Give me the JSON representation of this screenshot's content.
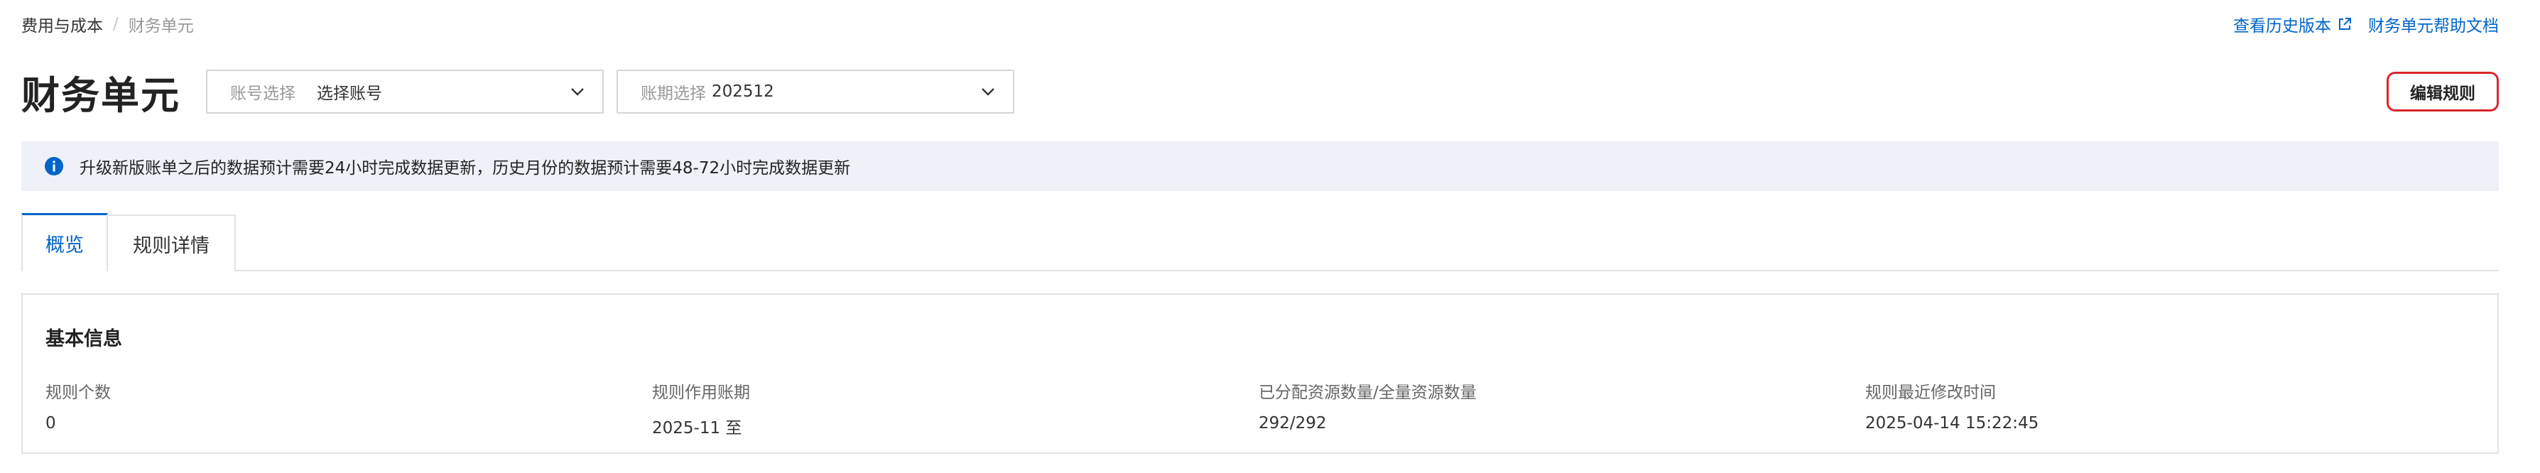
{
  "breadcrumb": {
    "parent": "费用与成本",
    "separator": "/",
    "current": "财务单元"
  },
  "top_links": {
    "history": "查看历史版本",
    "help": "财务单元帮助文档"
  },
  "header": {
    "title": "财务单元",
    "account_select": {
      "label": "账号选择",
      "value": "选择账号"
    },
    "period_select": {
      "label": "账期选择",
      "value": "202512"
    },
    "edit_button": "编辑规则"
  },
  "notice": {
    "text": "升级新版账单之后的数据预计需要24小时完成数据更新，历史月份的数据预计需要48-72小时完成数据更新"
  },
  "tabs": [
    {
      "label": "概览",
      "active": true
    },
    {
      "label": "规则详情",
      "active": false
    }
  ],
  "basic_info": {
    "title": "基本信息",
    "stats": [
      {
        "label": "规则个数",
        "value": "0"
      },
      {
        "label": "规则作用账期",
        "value": "2025-11 至"
      },
      {
        "label": "已分配资源数量/全量资源数量",
        "value": "292/292"
      },
      {
        "label": "规则最近修改时间",
        "value": "2025-04-14 15:22:45"
      }
    ]
  },
  "colors": {
    "accent": "#0064c8",
    "highlight_border": "#d9262c",
    "notice_bg": "#eef1f7"
  }
}
